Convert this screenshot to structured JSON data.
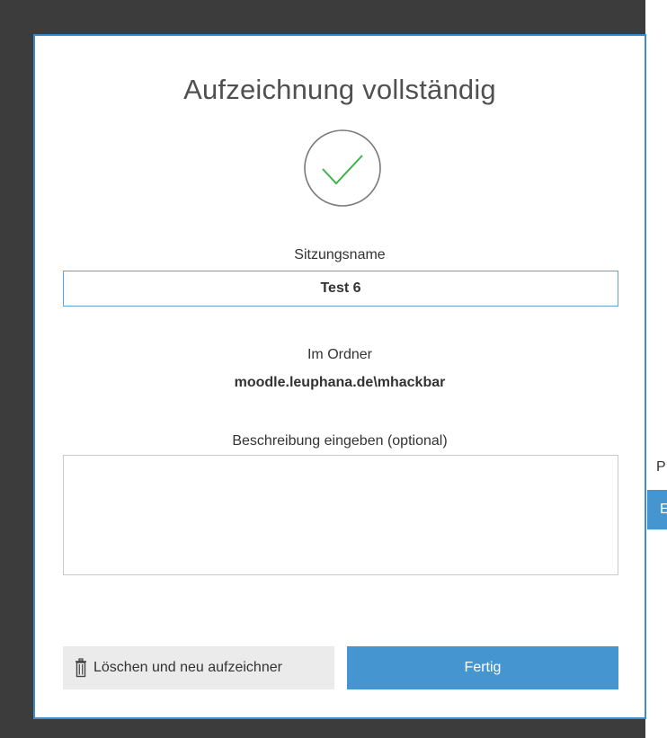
{
  "dialog": {
    "title": "Aufzeichnung vollständig",
    "check_icon": "checkmark-circle-icon",
    "session_name_label": "Sitzungsname",
    "session_name_value": "Test 6",
    "folder_label": "Im Ordner",
    "folder_value": "moodle.leuphana.de\\mhackbar",
    "description_label": "Beschreibung eingeben (optional)",
    "description_value": "",
    "delete_button_label": "Löschen und neu aufzeichner",
    "delete_button_icon": "trash-icon",
    "done_button_label": "Fertig"
  },
  "background": {
    "edge_text": "P",
    "edge_button_label": "E"
  },
  "colors": {
    "accent": "#4596d0",
    "dialog_border": "#3d8ccc",
    "check_green": "#3cb44b",
    "backdrop": "#3c3c3c"
  }
}
